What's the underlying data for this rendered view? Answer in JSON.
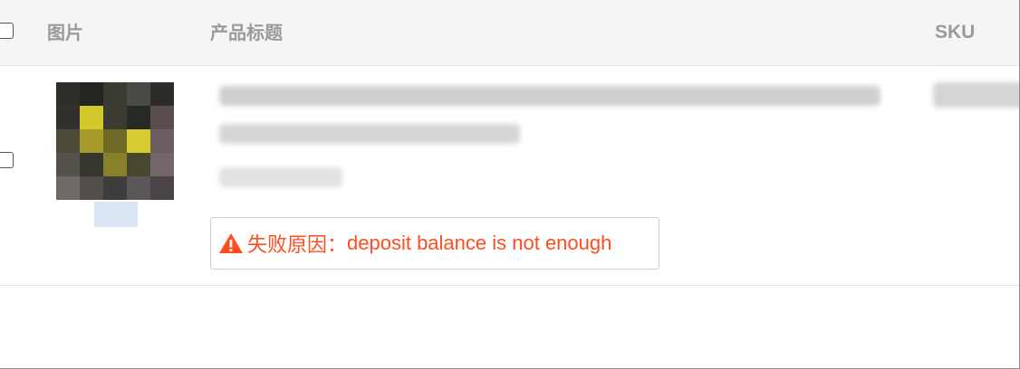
{
  "table": {
    "columns": {
      "image": "图片",
      "title": "产品标题",
      "sku": "SKU"
    },
    "rows": [
      {
        "error": {
          "icon": "warning-icon",
          "prefix": "失败原因：",
          "message": "deposit balance is not enough",
          "color": "#ff4d1f"
        }
      }
    ]
  }
}
